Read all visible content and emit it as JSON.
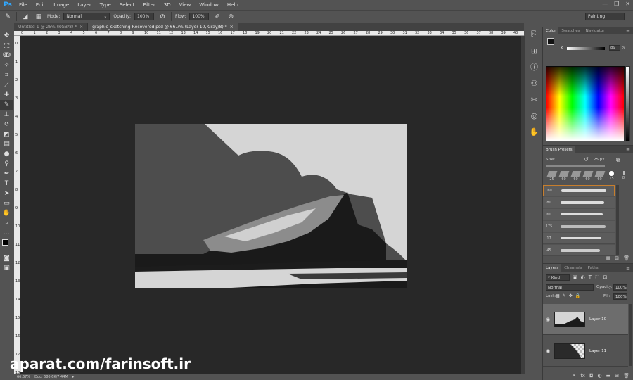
{
  "app": {
    "logo": "Ps"
  },
  "menu": [
    "File",
    "Edit",
    "Image",
    "Layer",
    "Type",
    "Select",
    "Filter",
    "3D",
    "View",
    "Window",
    "Help"
  ],
  "window_controls": {
    "minimize": "—",
    "restore": "❐",
    "close": "✕"
  },
  "options_bar": {
    "mode_label": "Mode:",
    "mode_value": "Normal",
    "opacity_label": "Opacity:",
    "opacity_value": "100%",
    "flow_label": "Flow:",
    "flow_value": "100%",
    "workspace": "Painting"
  },
  "tabs": [
    {
      "label": "Untitled-1 @ 25% (RGB/8) *",
      "close": "×"
    },
    {
      "label": "graphic_sketching-Recovered.psd @ 66.7% (Layer 10, Gray/8) *",
      "close": "×"
    }
  ],
  "ruler": {
    "top": [
      "0",
      "1",
      "2",
      "3",
      "4",
      "5",
      "6",
      "7",
      "8",
      "9",
      "10",
      "11",
      "12",
      "13",
      "14",
      "15",
      "16",
      "17",
      "18",
      "19",
      "20",
      "21",
      "22",
      "23",
      "24",
      "25",
      "26",
      "27",
      "28",
      "29",
      "30",
      "31",
      "32",
      "33",
      "34",
      "35",
      "36",
      "37",
      "38",
      "39",
      "40"
    ],
    "left": [
      "0",
      "1",
      "2",
      "3",
      "4",
      "5",
      "6",
      "7",
      "8",
      "9",
      "10",
      "11",
      "12",
      "13",
      "14",
      "15",
      "16",
      "17",
      "18"
    ]
  },
  "status": {
    "zoom": "66.67%",
    "doc": "Doc: 686.6K/7.44M",
    "arrow": "▸"
  },
  "watermark": "aparat.com/farinsoft.ir",
  "color_panel": {
    "tabs": [
      "Color",
      "Swatches",
      "Navigator"
    ],
    "channel_label": "K",
    "channel_value": "89",
    "channel_unit": "%"
  },
  "brush_panel": {
    "title": "Brush Presets",
    "size_label": "Size:",
    "size_value": "25 px",
    "tips": [
      "25",
      "60",
      "60",
      "60",
      "60",
      "15",
      "8"
    ],
    "rows": [
      "60",
      "80",
      "60",
      "175",
      "17",
      "45"
    ]
  },
  "layers_panel": {
    "tabs": [
      "Layers",
      "Channels",
      "Paths"
    ],
    "kind": "Kind",
    "blend_mode": "Normal",
    "opacity_label": "Opacity:",
    "opacity_value": "100%",
    "lock_label": "Lock:",
    "fill_label": "Fill:",
    "fill_value": "100%",
    "layers": [
      {
        "name": "Layer 10",
        "selected": true
      },
      {
        "name": "Layer 11",
        "selected": false
      }
    ]
  },
  "colors": {
    "accent": "#31a8ff",
    "canvas_bg": "#282828",
    "panel_bg": "#535353"
  }
}
